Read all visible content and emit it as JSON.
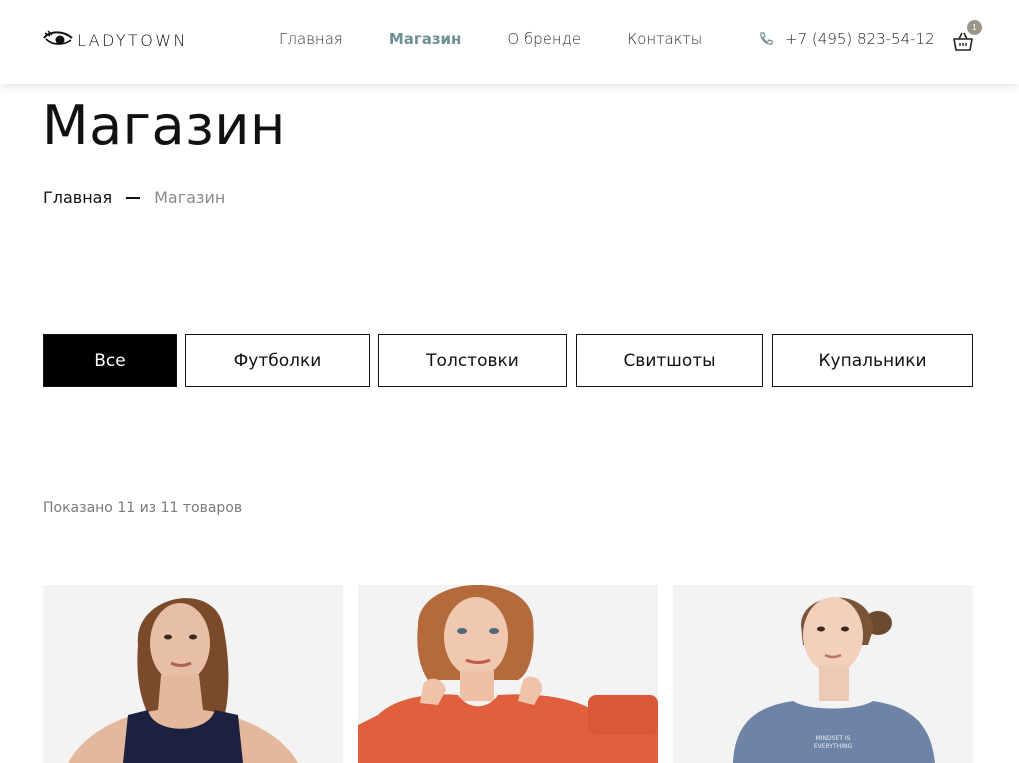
{
  "header": {
    "logo_text": "LADYTOWN",
    "nav": [
      {
        "label": "Главная",
        "active": false
      },
      {
        "label": "Магазин",
        "active": true
      },
      {
        "label": "О бренде",
        "active": false
      },
      {
        "label": "Контакты",
        "active": false
      }
    ],
    "phone": "+7 (495) 823-54-12",
    "cart_count": "1"
  },
  "page": {
    "title": "Магазин",
    "breadcrumb": {
      "home": "Главная",
      "current": "Магазин"
    }
  },
  "filters": [
    {
      "label": "Все",
      "active": true
    },
    {
      "label": "Футболки",
      "active": false
    },
    {
      "label": "Толстовки",
      "active": false
    },
    {
      "label": "Свитшоты",
      "active": false
    },
    {
      "label": "Купальники",
      "active": false
    }
  ],
  "results_count": "Показано 11 из 11 товаров",
  "colors": {
    "accent": "#6e8f94",
    "badge": "#9c9689",
    "product_bg": "#f3f3f3"
  }
}
